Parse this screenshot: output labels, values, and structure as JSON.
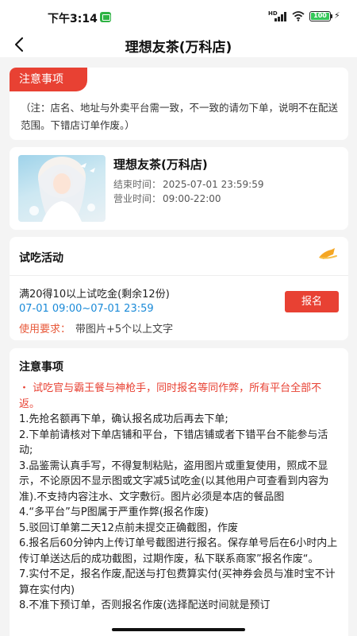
{
  "status_bar": {
    "time": "下午3:14",
    "hd": "HD",
    "battery": "100"
  },
  "nav": {
    "title": "理想友茶(万科店)"
  },
  "notice": {
    "tag": "注意事项",
    "text": "（注：店名、地址与外卖平台需一致，不一致的请勿下单，说明不在配送范围。下错店订单作废。）"
  },
  "shop": {
    "name": "理想友茶(万科店)",
    "end_label": "结束时间：",
    "end_value": "2025-07-01 23:59:59",
    "hours_label": "营业时间：",
    "hours_value": "09:00-22:00"
  },
  "trial": {
    "title": "试吃活动",
    "offer": "满20得10以上试吃金(剩余12份)",
    "time": "07-01 09:00~07-01 23:59",
    "req_label": "使用要求：",
    "req_value": "带图片+5个以上文字",
    "signup_label": "报名"
  },
  "rules": {
    "title": "注意事项",
    "warning": "・ 试吃官与霸王餐与神枪手，同时报名等同作弊，所有平台全部不返。",
    "items": [
      "1.先抢名额再下单，确认报名成功后再去下单;",
      "2.下单前请核对下单店铺和平台，下错店铺或者下错平台不能参与活动;",
      "3.品鉴需认真手写，不得复制粘贴，盗用图片或重复使用，照成不显示，不论原因不显示图或文字减5试吃金(以其他用户可查看到内容为准).不支持内容注水、文字敷衍。图片必须是本店的餐品图",
      "4.“多平台”与P图属于严重作弊(报名作废)",
      "5.驳回订单第二天12点前未提交正确截图，作废",
      "6.报名后60分钟内上传订单号截图进行报名。保存单号后在6小时内上传订单送达后的成功截图，过期作废，私下联系商家”报名作废“。",
      "7.实付不足，报名作废,配送与打包费算实付(买神券会员与准时宝不计算在实付内)",
      "8.不准下预订单，否则报名作废(选择配送时间就是预订"
    ]
  },
  "colors": {
    "accent": "#e84133",
    "link": "#1a8ad8",
    "background": "#f4f4f4"
  }
}
